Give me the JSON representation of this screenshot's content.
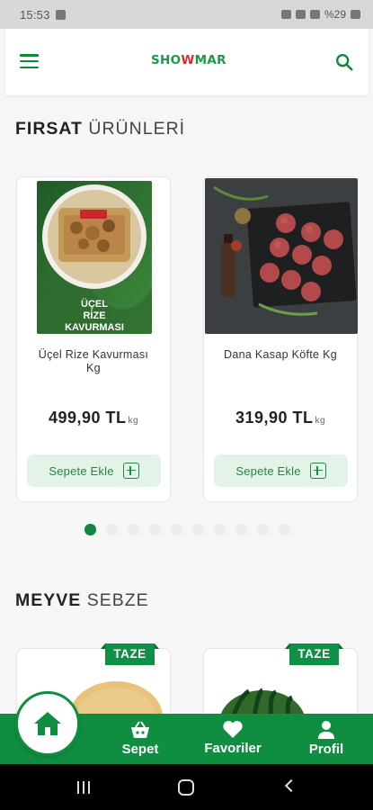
{
  "status_bar": {
    "time": "15:53",
    "battery": "%29"
  },
  "header": {
    "logo_part1": "SHO",
    "logo_mid": "W",
    "logo_part2": "MAR"
  },
  "sections": {
    "firsat": {
      "title_bold": "FIRSAT",
      "title_light": "ÜRÜNLERİ"
    },
    "meyve": {
      "title_bold": "MEYVE",
      "title_light": "SEBZE"
    }
  },
  "products": [
    {
      "name": "Üçel Rize Kavurması Kg",
      "price": "499,90 TL",
      "unit": "kg",
      "add_label": "Sepete Ekle",
      "image_caption_1": "ÜÇEL",
      "image_caption_2": "RİZE",
      "image_caption_3": "KAVURMASI"
    },
    {
      "name": "Dana Kasap Köfte Kg",
      "price": "319,90 TL",
      "unit": "kg",
      "add_label": "Sepete Ekle"
    }
  ],
  "carousel": {
    "page_count": 10,
    "active_index": 0
  },
  "fresh_products": [
    {
      "badge": "TAZE",
      "image": "cantaloupe-melon"
    },
    {
      "badge": "TAZE",
      "image": "watermelon"
    }
  ],
  "bottom_nav": {
    "home": "home-icon",
    "cart": "Sepet",
    "favorites": "Favoriler",
    "profile": "Profil"
  },
  "colors": {
    "brand_green": "#0f8e42",
    "logo_red": "#d62d2d",
    "button_bg": "#e3f3e8"
  }
}
